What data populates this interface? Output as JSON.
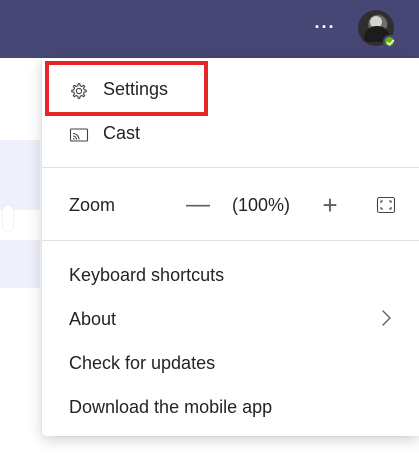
{
  "topbar": {
    "more_label": "···",
    "avatar_icon": "user-avatar",
    "presence_icon": "available-check-icon",
    "bar_color": "#464775",
    "presence_color": "#6bb700"
  },
  "menu": {
    "settings": {
      "label": "Settings",
      "icon": "gear-icon"
    },
    "cast": {
      "label": "Cast",
      "icon": "cast-icon"
    },
    "zoom": {
      "label": "Zoom",
      "minus": "—",
      "value": "(100%)",
      "plus": "+",
      "fullscreen_icon": "fullscreen-icon"
    },
    "keyboard_shortcuts": {
      "label": "Keyboard shortcuts"
    },
    "about": {
      "label": "About",
      "icon": "chevron-right-icon"
    },
    "check_updates": {
      "label": "Check for updates"
    },
    "download_mobile": {
      "label": "Download the mobile app"
    }
  },
  "annotation": {
    "highlight_color": "#e3272b"
  }
}
